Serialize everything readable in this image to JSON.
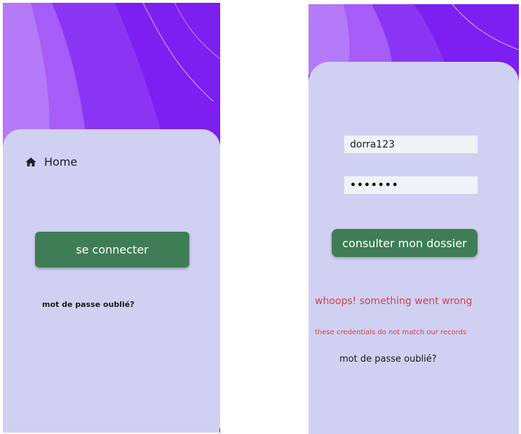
{
  "colors": {
    "purple_dark": "#7b1ff0",
    "purple_light": "#a46cf5",
    "card_bg": "#d0d1f2",
    "button_green": "#3f7d56",
    "error_red": "#d6404a",
    "input_bg": "#eef4f7"
  },
  "left_screen": {
    "nav": {
      "icon": "home-icon",
      "label": "Home"
    },
    "connect_button": "se connecter",
    "forgot_password": "mot de passe oublié?"
  },
  "right_screen": {
    "username_value": "dorra123",
    "password_value": "•••••••",
    "consult_button": "consulter mon dossier",
    "error_title": "whoops! something went wrong",
    "error_detail": "these credentials do not match our records",
    "forgot_password": "mot de passe oublié?"
  }
}
